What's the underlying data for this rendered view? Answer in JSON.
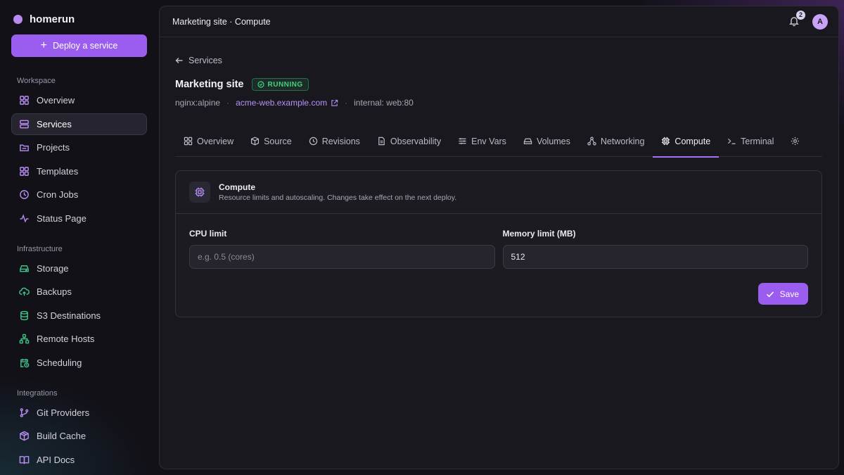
{
  "brand": {
    "name": "homerun"
  },
  "sidebar": {
    "deploy_label": "Deploy a service",
    "sections": [
      {
        "label": "Workspace",
        "items": [
          {
            "label": "Overview",
            "icon": "grid-icon"
          },
          {
            "label": "Services",
            "icon": "server-icon",
            "active": true
          },
          {
            "label": "Projects",
            "icon": "folder-icon"
          },
          {
            "label": "Templates",
            "icon": "layout-icon"
          },
          {
            "label": "Cron Jobs",
            "icon": "clock-icon"
          },
          {
            "label": "Status Page",
            "icon": "activity-icon"
          }
        ]
      },
      {
        "label": "Infrastructure",
        "items": [
          {
            "label": "Storage",
            "icon": "hard-drive-icon"
          },
          {
            "label": "Backups",
            "icon": "cloud-upload-icon"
          },
          {
            "label": "S3 Destinations",
            "icon": "database-icon"
          },
          {
            "label": "Remote Hosts",
            "icon": "network-icon"
          },
          {
            "label": "Scheduling",
            "icon": "calendar-clock-icon"
          }
        ]
      },
      {
        "label": "Integrations",
        "items": [
          {
            "label": "Git Providers",
            "icon": "git-branch-icon"
          },
          {
            "label": "Build Cache",
            "icon": "package-icon"
          },
          {
            "label": "API Docs",
            "icon": "book-icon"
          }
        ]
      }
    ]
  },
  "topbar": {
    "title": "Marketing site · Compute",
    "notifications": "2",
    "avatar": "A"
  },
  "service": {
    "back_label": "Services",
    "name": "Marketing site",
    "status": "RUNNING",
    "image": "nginx:alpine",
    "url": "acme-web.example.com",
    "internal": "internal: web:80"
  },
  "tabs": [
    {
      "label": "Overview",
      "icon": "grid-icon"
    },
    {
      "label": "Source",
      "icon": "box-icon"
    },
    {
      "label": "Revisions",
      "icon": "history-icon"
    },
    {
      "label": "Observability",
      "icon": "file-text-icon"
    },
    {
      "label": "Env Vars",
      "icon": "sliders-icon"
    },
    {
      "label": "Volumes",
      "icon": "hard-drive-icon"
    },
    {
      "label": "Networking",
      "icon": "network-icon"
    },
    {
      "label": "Compute",
      "icon": "cpu-icon",
      "active": true
    },
    {
      "label": "Terminal",
      "icon": "terminal-icon"
    },
    {
      "label": "",
      "icon": "gear-icon"
    }
  ],
  "compute": {
    "title": "Compute",
    "subtitle": "Resource limits and autoscaling. Changes take effect on the next deploy.",
    "cpu_label": "CPU limit",
    "cpu_placeholder": "e.g. 0.5 (cores)",
    "cpu_value": "",
    "memory_label": "Memory limit (MB)",
    "memory_value": "512",
    "save_label": "Save"
  },
  "colors": {
    "accent": "#9b5cf0",
    "running": "#44d17f",
    "background": "#121118"
  }
}
